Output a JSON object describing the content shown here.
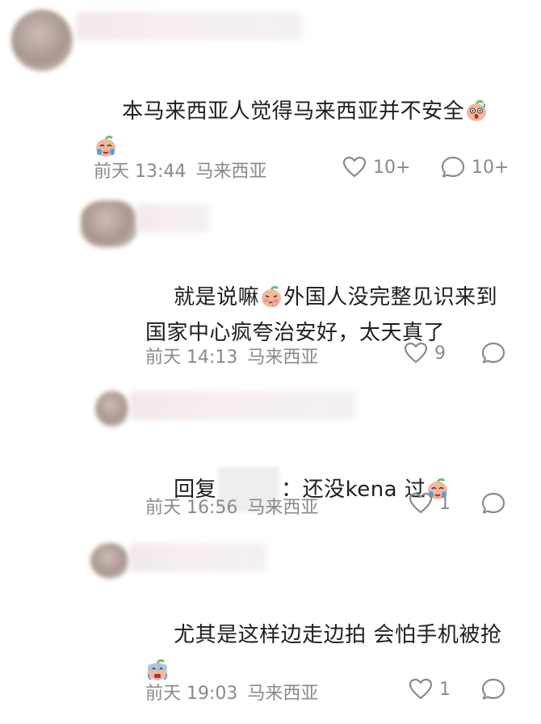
{
  "comments": [
    {
      "text": "本马来西亚人觉得马来西亚并不安全",
      "emojis": [
        "shocked-face-emoji",
        "crying-face-emoji"
      ],
      "time": "前天 13:44",
      "location": "马来西亚",
      "likes": "10+",
      "replies": "10+"
    },
    {
      "text_before": "就是说嘛",
      "emoji": "shy-face-emoji",
      "text_after": "外国人没完整见识来到",
      "text_line2": "国家中心疯夸治安好，太天真了",
      "time": "前天 14:13",
      "location": "马来西亚",
      "likes": "9"
    },
    {
      "prefix": "回复",
      "suffix": "：还没kena 过",
      "emoji": "crying-face-emoji",
      "time": "前天 16:56",
      "location": "马来西亚",
      "likes": "1"
    },
    {
      "text": "尤其是这样边走边拍 会怕手机被抢",
      "emoji": "frightened-face-emoji",
      "time": "前天 19:03",
      "location": "马来西亚",
      "likes": "1"
    }
  ],
  "colors": {
    "text": "#1e1e1e",
    "meta": "#8a8a8a",
    "emoji_face": "#f3b79c",
    "emoji_leaf": "#6fbf73",
    "emoji_tears": "#4aa3e8"
  }
}
